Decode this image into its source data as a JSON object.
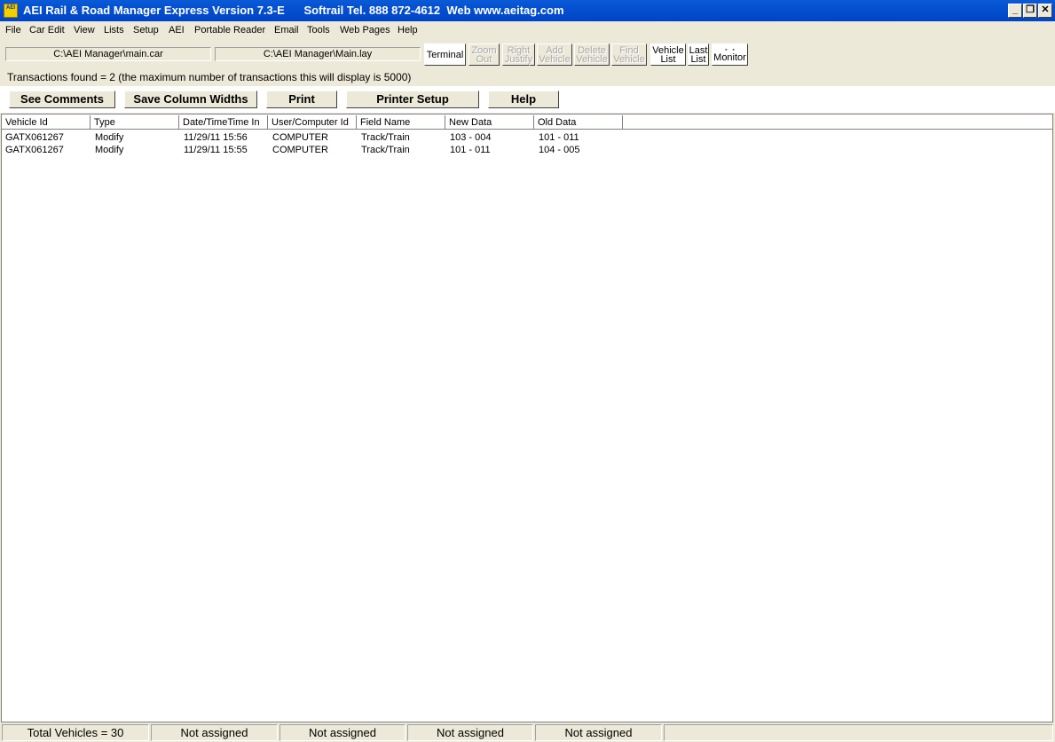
{
  "window": {
    "title": "AEI Rail & Road Manager Express Version 7.3-E      Softrail Tel. 888 872-4612  Web www.aeitag.com",
    "icon_text": "AEI",
    "controls": {
      "minimize": "_",
      "restore": "❐",
      "close": "✕"
    }
  },
  "menu": [
    "File",
    "Car Edit",
    "View",
    "Lists",
    "Setup",
    "AEI",
    "Portable Reader",
    "Email",
    "Tools",
    "Web Pages",
    "Help"
  ],
  "toolbar": {
    "car_file": "C:\\AEI Manager\\main.car",
    "lay_file": "C:\\AEI Manager\\Main.lay",
    "buttons": [
      {
        "line1": "Terminal",
        "line2": "",
        "enabled": true
      },
      {
        "line1": "Zoom",
        "line2": "Out",
        "enabled": false
      },
      {
        "line1": "Right",
        "line2": "Justify",
        "enabled": false
      },
      {
        "line1": "Add",
        "line2": "Vehicle",
        "enabled": false
      },
      {
        "line1": "Delete",
        "line2": "Vehicle",
        "enabled": false
      },
      {
        "line1": "Find",
        "line2": "Vehicle",
        "enabled": false
      },
      {
        "line1": "Vehicle",
        "line2": "List",
        "enabled": true
      },
      {
        "line1": "Last",
        "line2": "List",
        "enabled": true
      },
      {
        "line1": "Monitor",
        "line2": "",
        "enabled": true
      }
    ]
  },
  "transactions_text": "Transactions found = 2 (the maximum number of transactions this will display is 5000)",
  "actions": {
    "see_comments": "See Comments",
    "save_column_widths": "Save Column Widths",
    "print": "Print",
    "printer_setup": "Printer Setup",
    "help": "Help"
  },
  "table": {
    "columns": [
      "Vehicle Id",
      "Type",
      "Date/TimeTime In",
      "User/Computer Id",
      "Field Name",
      "New Data",
      "Old Data"
    ],
    "rows": [
      [
        "GATX061267",
        "Modify",
        "11/29/11 15:56",
        "COMPUTER",
        "Track/Train",
        "103 - 004",
        "101 - 011"
      ],
      [
        "GATX061267",
        "Modify",
        "11/29/11 15:55",
        "COMPUTER",
        "Track/Train",
        "101 - 011",
        "104 - 005"
      ]
    ]
  },
  "status": {
    "total": "Total Vehicles = 30",
    "panels": [
      "Not assigned",
      "Not assigned",
      "Not assigned",
      "Not assigned"
    ]
  }
}
